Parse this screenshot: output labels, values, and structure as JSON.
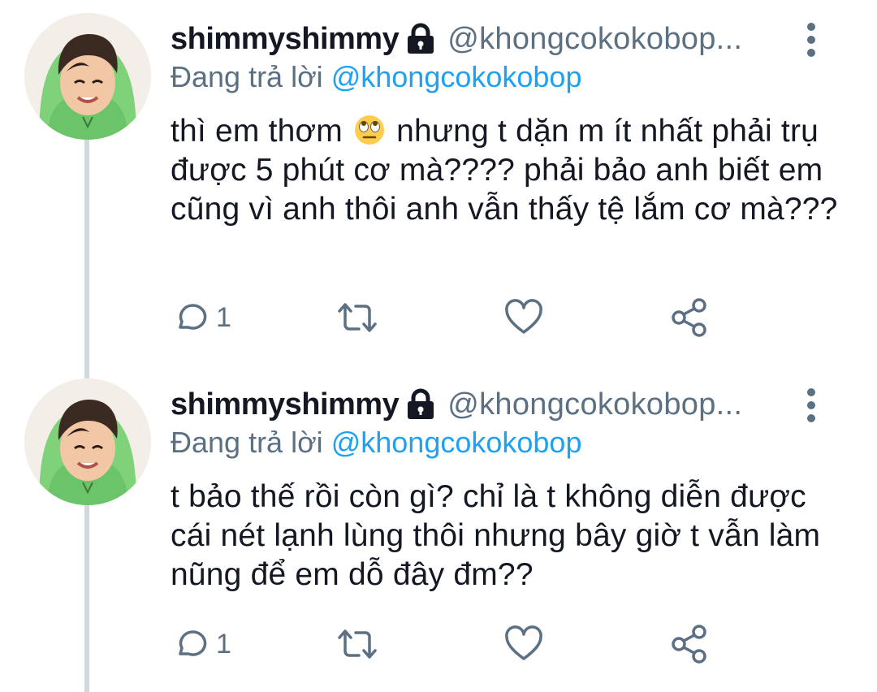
{
  "tweets": [
    {
      "display_name": "shimmyshimmy",
      "handle": "@khongcokokobop...",
      "reply_prefix": "Đang trả lời",
      "reply_mention": "@khongcokokobop",
      "text_before_emoji": "thì em thơm",
      "emoji": "face-with-rolling-eyes-icon",
      "text_after_emoji": "nhưng t dặn m ít nhất phải trụ được 5 phút cơ mà???? phải bảo anh biết em cũng vì anh thôi anh vẫn thấy tệ lắm cơ mà???",
      "reply_count": "1"
    },
    {
      "display_name": "shimmyshimmy",
      "handle": "@khongcokokobop...",
      "reply_prefix": "Đang trả lời",
      "reply_mention": "@khongcokokobop",
      "text": "t bảo thế rồi còn gì? chỉ là t không diễn được cái nét lạnh lùng thôi nhưng bây giờ t vẫn làm nũng để em dỗ đây đm??",
      "reply_count": "1"
    }
  ],
  "icons": {
    "lock": "lock-icon",
    "more": "more-vertical-icon",
    "reply": "reply-bubble-icon",
    "retweet": "retweet-icon",
    "like": "heart-icon",
    "share": "share-icon"
  },
  "colors": {
    "link": "#1da1f2",
    "secondary_text": "#5b7083",
    "primary_text": "#141823",
    "thread_line": "#cfd9de",
    "avatar_hood": "#7fd27a"
  }
}
